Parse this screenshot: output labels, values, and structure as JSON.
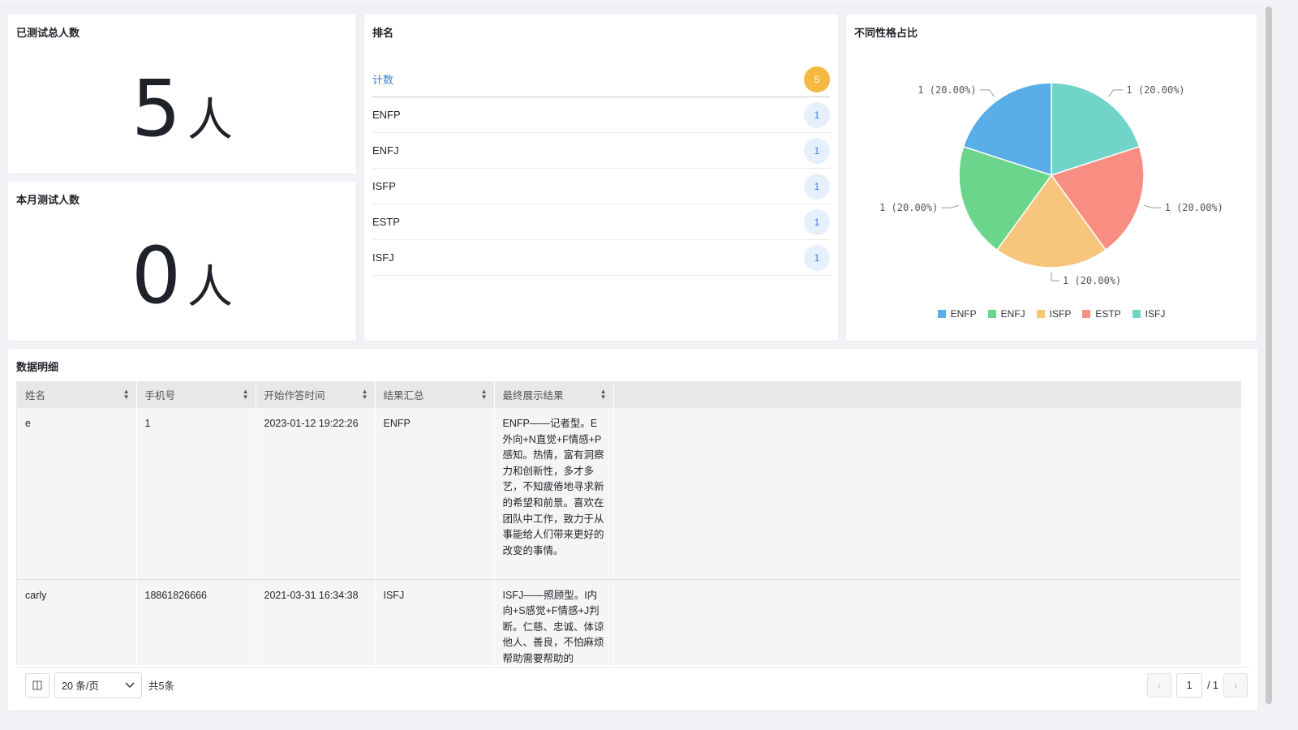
{
  "total_card": {
    "title": "已测试总人数",
    "value": "5",
    "unit": "人"
  },
  "month_card": {
    "title": "本月测试人数",
    "value": "0",
    "unit": "人"
  },
  "ranking": {
    "title": "排名",
    "header": {
      "label": "计数",
      "count": "5"
    },
    "rows": [
      {
        "label": "ENFP",
        "count": "1"
      },
      {
        "label": "ENFJ",
        "count": "1"
      },
      {
        "label": "ISFP",
        "count": "1"
      },
      {
        "label": "ESTP",
        "count": "1"
      },
      {
        "label": "ISFJ",
        "count": "1"
      }
    ]
  },
  "pie": {
    "title": "不同性格占比",
    "colors": {
      "ENFP": "#5aaee8",
      "ENFJ": "#6bd58b",
      "ISFP": "#f8c57c",
      "ESTP": "#f78e81",
      "ISFJ": "#71d4c9"
    }
  },
  "chart_data": {
    "type": "pie",
    "title": "不同性格占比",
    "categories": [
      "ENFP",
      "ENFJ",
      "ISFP",
      "ESTP",
      "ISFJ"
    ],
    "values": [
      1,
      1,
      1,
      1,
      1
    ],
    "labels": [
      "1 (20.00%)",
      "1 (20.00%)",
      "1 (20.00%)",
      "1 (20.00%)",
      "1 (20.00%)"
    ],
    "legend": "bottom"
  },
  "details": {
    "title": "数据明细",
    "columns": [
      "姓名",
      "手机号",
      "开始作答时间",
      "结果汇总",
      "最终展示结果"
    ],
    "rows": [
      [
        "e",
        "1",
        "2023-01-12 19:22:26",
        "ENFP",
        "ENFP——记者型。E外向+N直觉+F情感+P感知。热情，富有洞察力和创新性，多才多艺，不知疲倦地寻求新的希望和前景。喜欢在团队中工作，致力于从事能给人们带来更好的改变的事情。"
      ],
      [
        "carly",
        "18861826666",
        "2021-03-31 16:34:38",
        "ISFJ",
        "ISFJ——照顾型。I内向+S感觉+F情感+J判断。仁慈、忠诚、体谅他人、善良，不怕麻烦帮助需要帮助的"
      ]
    ]
  },
  "pagination": {
    "page_size": "20 条/页",
    "total": "共5条",
    "current": "1",
    "of_total": "/ 1"
  }
}
